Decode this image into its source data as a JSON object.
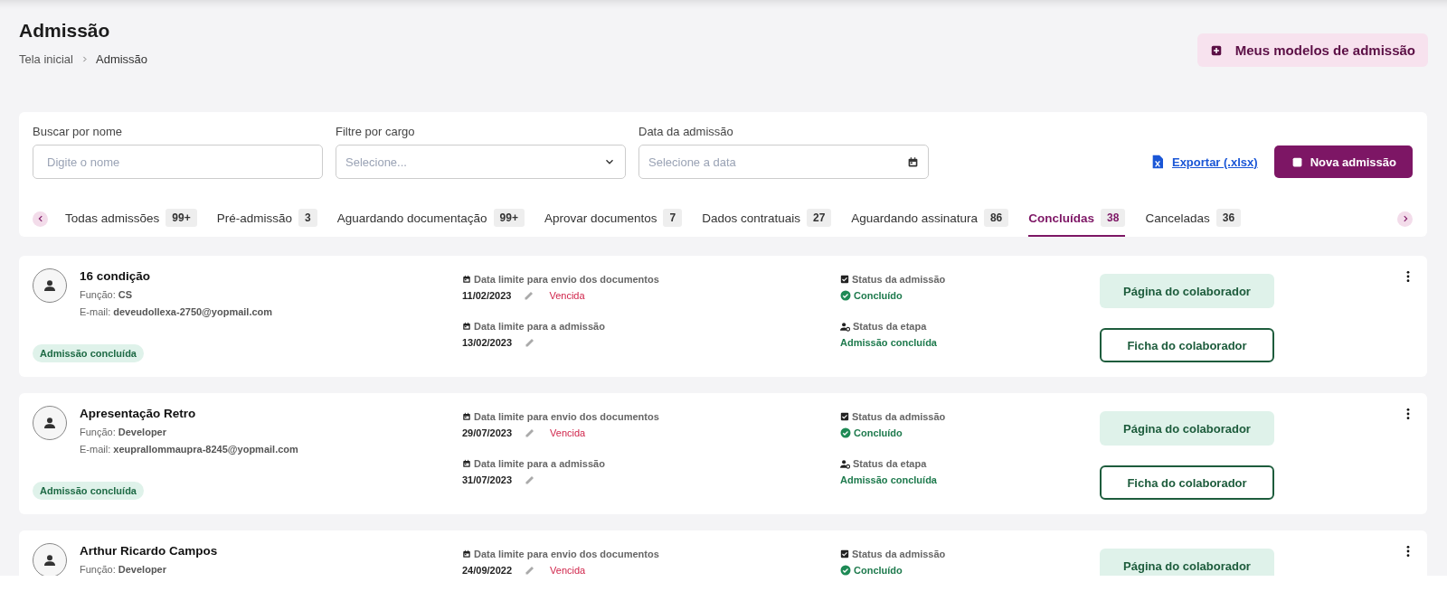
{
  "header": {
    "title": "Admissão",
    "breadcrumb": [
      "Tela inicial",
      "Admissão"
    ],
    "templates_button": "Meus modelos de admissão"
  },
  "filters": {
    "fields": [
      {
        "kind": "text",
        "label": "Buscar por nome",
        "placeholder": "Digite o nome"
      },
      {
        "kind": "select",
        "label": "Filtre por cargo",
        "placeholder": "Selecione..."
      },
      {
        "kind": "date",
        "label": "Data da admissão",
        "placeholder": "Selecione a data"
      }
    ],
    "export_link": "Exportar (.xlsx)",
    "new_button": "Nova admissão"
  },
  "tabs": [
    {
      "label": "Todas admissões",
      "count": "99+",
      "selected": false
    },
    {
      "label": "Pré-admissão",
      "count": "3",
      "selected": false
    },
    {
      "label": "Aguardando documentação",
      "count": "99+",
      "selected": false
    },
    {
      "label": "Aprovar documentos",
      "count": "7",
      "selected": false
    },
    {
      "label": "Dados contratuais",
      "count": "27",
      "selected": false
    },
    {
      "label": "Aguardando assinatura",
      "count": "86",
      "selected": false
    },
    {
      "label": "Concluídas",
      "count": "38",
      "selected": true
    },
    {
      "label": "Canceladas",
      "count": "36",
      "selected": false
    }
  ],
  "cards": [
    {
      "name": "16 condição",
      "role_label": "Função:",
      "role": "CS",
      "email_label": "E-mail:",
      "email": "deveudollexa-2750@yopmail.com",
      "badge": "Admissão concluída",
      "dates": [
        {
          "label": "Data limite para envio dos documentos",
          "value": "11/02/2023",
          "warning": "Vencida"
        },
        {
          "label": "Data limite para a admissão",
          "value": "13/02/2023"
        }
      ],
      "statuses": [
        {
          "kind": "admission",
          "label": "Status da admissão",
          "value": "Concluído"
        },
        {
          "kind": "step",
          "label": "Status da etapa",
          "value": "Admissão concluída"
        }
      ],
      "buttons": [
        {
          "kind": "filled",
          "label": "Página do colaborador"
        },
        {
          "kind": "outline",
          "label": "Ficha do colaborador"
        }
      ]
    },
    {
      "name": "Apresentação Retro",
      "role_label": "Função:",
      "role": "Developer",
      "email_label": "E-mail:",
      "email": "xeuprallommaupra-8245@yopmail.com",
      "badge": "Admissão concluída",
      "dates": [
        {
          "label": "Data limite para envio dos documentos",
          "value": "29/07/2023",
          "warning": "Vencida"
        },
        {
          "label": "Data limite para a admissão",
          "value": "31/07/2023"
        }
      ],
      "statuses": [
        {
          "kind": "admission",
          "label": "Status da admissão",
          "value": "Concluído"
        },
        {
          "kind": "step",
          "label": "Status da etapa",
          "value": "Admissão concluída"
        }
      ],
      "buttons": [
        {
          "kind": "filled",
          "label": "Página do colaborador"
        },
        {
          "kind": "outline",
          "label": "Ficha do colaborador"
        }
      ]
    },
    {
      "name": "Arthur Ricardo Campos",
      "role_label": "Função:",
      "role": "Developer",
      "dates": [
        {
          "label": "Data limite para envio dos documentos",
          "value": "24/09/2022",
          "warning": "Vencida"
        }
      ],
      "statuses": [
        {
          "kind": "admission",
          "label": "Status da admissão",
          "value": "Concluído"
        }
      ],
      "buttons": [
        {
          "kind": "filled",
          "label": "Página do colaborador"
        }
      ]
    }
  ]
}
